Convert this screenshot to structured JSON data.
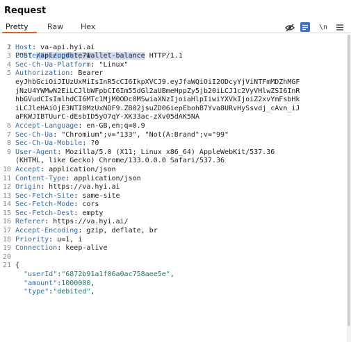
{
  "panel": {
    "title": "Request"
  },
  "tabs": [
    {
      "label": "Pretty",
      "active": true
    },
    {
      "label": "Raw",
      "active": false
    },
    {
      "label": "Hex",
      "active": false
    }
  ],
  "toolbar": {
    "hide_icon": "eye-off-icon",
    "pretty_icon": "pretty-print-icon",
    "newline_label": "\\n",
    "menu_icon": "hamburger-menu-icon",
    "accent_color": "#e8601c",
    "pretty_color": "#3f6fce"
  },
  "request": {
    "method": "POST",
    "path": "/api/update-wallet-balance",
    "protocol": "HTTP/1.1",
    "headers": [
      {
        "line": "2",
        "name": "Host",
        "value": "va-api.hyi.ai"
      },
      {
        "line": "3",
        "name": "Content-Length",
        "value": "71"
      },
      {
        "line": "4",
        "name": "Sec-Ch-Ua-Platform",
        "value": "\"Linux\""
      },
      {
        "line": "5",
        "name": "Authorization",
        "value": "Bearer"
      },
      {
        "line": "",
        "name": "",
        "value": "eyJhbGciOiJIUzUxMiIsInR5cCI6IkpXVCJ9.eyJfaWQiOiI2ODcyYjViNTFmMDZhMGF"
      },
      {
        "line": "",
        "name": "",
        "value": "jNzU4YWMwN2EiLCJlbWFpbCI6Im55dGl2aUBmeHppZy5jb20iLCJ1c2VyVHlwZSI6InR"
      },
      {
        "line": "",
        "name": "",
        "value": "hbGVudCIsImlhdCI6MTc1MjM0ODc0MSwiaXNzIjoiaHlpIiwiYXVkIjoiZ2xvYmFsbHk"
      },
      {
        "line": "",
        "name": "",
        "value": "iLCJleHAiOjE3NTI0MzUxNDF9.ZB02jsuZD06iepEbohB7Yva8URvHySsvdj_cAvn_iJ"
      },
      {
        "line": "",
        "name": "",
        "value": "aFKWJIBTUurC-dEsbID5yO7qY-XK33ac-zXv05dAK5NA"
      },
      {
        "line": "6",
        "name": "Accept-Language",
        "value": "en-GB,en;q=0.9"
      },
      {
        "line": "7",
        "name": "Sec-Ch-Ua",
        "value": "\"Chromium\";v=\"133\", \"Not(A:Brand\";v=\"99\""
      },
      {
        "line": "8",
        "name": "Sec-Ch-Ua-Mobile",
        "value": "?0"
      },
      {
        "line": "9",
        "name": "User-Agent",
        "value": "Mozilla/5.0 (X11; Linux x86_64) AppleWebKit/537.36"
      },
      {
        "line": "",
        "name": "",
        "value": "(KHTML, like Gecko) Chrome/133.0.0.0 Safari/537.36"
      },
      {
        "line": "10",
        "name": "Accept",
        "value": "application/json"
      },
      {
        "line": "11",
        "name": "Content-Type",
        "value": "application/json"
      },
      {
        "line": "12",
        "name": "Origin",
        "value": "https://va.hyi.ai"
      },
      {
        "line": "13",
        "name": "Sec-Fetch-Site",
        "value": "same-site"
      },
      {
        "line": "14",
        "name": "Sec-Fetch-Mode",
        "value": "cors"
      },
      {
        "line": "15",
        "name": "Sec-Fetch-Dest",
        "value": "empty"
      },
      {
        "line": "16",
        "name": "Referer",
        "value": "https://va.hyi.ai/"
      },
      {
        "line": "17",
        "name": "Accept-Encoding",
        "value": "gzip, deflate, br"
      },
      {
        "line": "18",
        "name": "Priority",
        "value": "u=1, i"
      },
      {
        "line": "19",
        "name": "Connection",
        "value": "keep-alive"
      }
    ],
    "blank_line": "20",
    "body": {
      "open_line": "21",
      "open_brace": "{",
      "fields": [
        {
          "key": "\"userId\"",
          "value": "\"6872b91a1f06a0ac758aee5e\"",
          "type": "string"
        },
        {
          "key": "\"amount\"",
          "value": "1000000",
          "type": "number"
        },
        {
          "key": "\"type\"",
          "value": "\"debited\"",
          "type": "string"
        }
      ]
    }
  }
}
